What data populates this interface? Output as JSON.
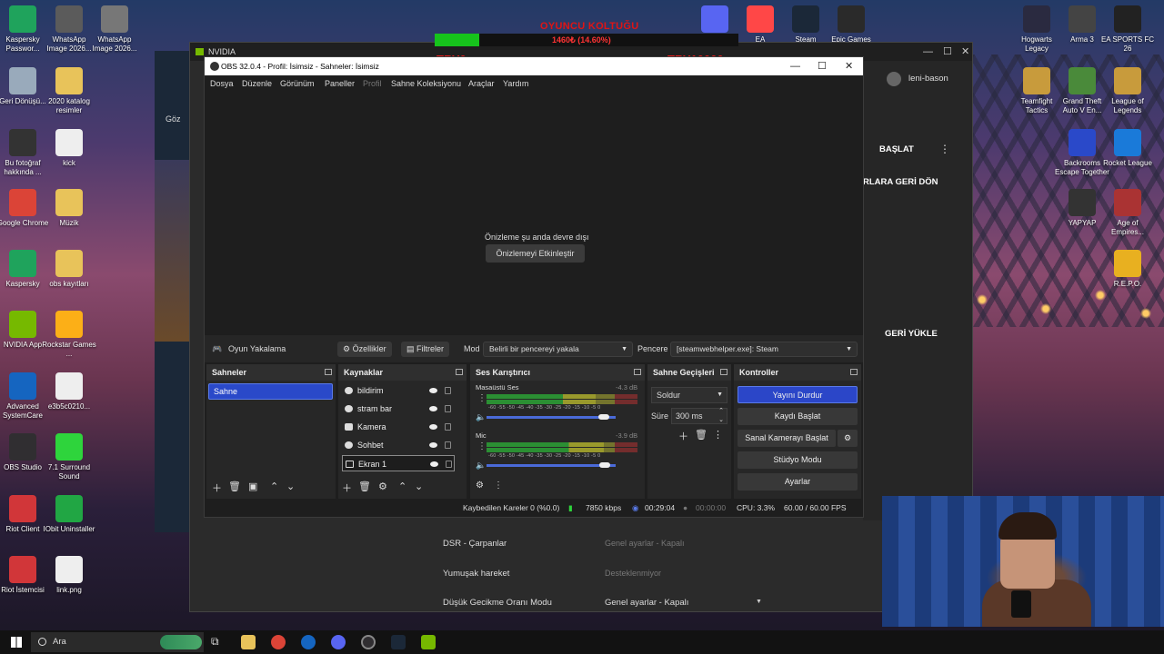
{
  "overlay": {
    "title": "OYUNCU KOLTUĞU",
    "amount": "1460₺ (14.60%)",
    "progress_fraction": 0.146,
    "left_label": "TRY0",
    "right_label": "TRY10000"
  },
  "desktop_left": [
    {
      "label": "Kaspersky Passwor...",
      "color": "#1fa35c"
    },
    {
      "label": "WhatsApp Image 2026...",
      "color": "#5b5b5b"
    },
    {
      "label": "WhatsApp Image 2026...",
      "color": "#777777"
    },
    {
      "label": "Geri Dönüşü...",
      "color": "#9ab"
    },
    {
      "label": "2020 katalog resimler",
      "color": "#e8c35a"
    },
    {
      "label": "Bu fotoğraf hakkında ...",
      "color": "#333"
    },
    {
      "label": "kick",
      "color": "#eee"
    },
    {
      "label": "Google Chrome",
      "color": "#db4437"
    },
    {
      "label": "Müzik",
      "color": "#e8c35a"
    },
    {
      "label": "Kaspersky",
      "color": "#1fa35c"
    },
    {
      "label": "obs kayıtları",
      "color": "#e8c35a"
    },
    {
      "label": "NVIDIA App",
      "color": "#76b900"
    },
    {
      "label": "Rockstar Games ...",
      "color": "#fcaf17"
    },
    {
      "label": "Advanced SystemCare",
      "color": "#1565c0"
    },
    {
      "label": "e3b5c0210...",
      "color": "#eee"
    },
    {
      "label": "OBS Studio",
      "color": "#302e31"
    },
    {
      "label": "7.1 Surround Sound",
      "color": "#2ed43c"
    },
    {
      "label": "Riot Client",
      "color": "#d13639"
    },
    {
      "label": "IObit Uninstaller",
      "color": "#21a644"
    },
    {
      "label": "Riot İstemcisi",
      "color": "#d13639"
    },
    {
      "label": "link.png",
      "color": "#eee"
    }
  ],
  "desktop_top": [
    {
      "label": "",
      "color": "#5865f2"
    },
    {
      "label": "EA",
      "color": "#ff4747"
    },
    {
      "label": "Steam",
      "color": "#1b2838"
    },
    {
      "label": "Epic Games",
      "color": "#2a2a2a"
    }
  ],
  "desktop_right": [
    {
      "label": "Hogwarts Legacy",
      "color": "#2a2a40"
    },
    {
      "label": "Arma 3",
      "color": "#444"
    },
    {
      "label": "EA SPORTS FC 26",
      "color": "#222"
    },
    {
      "label": "Teamfight Tactics",
      "color": "#c89b3c"
    },
    {
      "label": "Grand Theft Auto V En...",
      "color": "#4a8a3a"
    },
    {
      "label": "League of Legends",
      "color": "#c89b3c"
    },
    {
      "label": "Backrooms Escape Together",
      "color": "#2a49c9"
    },
    {
      "label": "Rocket League",
      "color": "#1a7ad9"
    },
    {
      "label": "YAPYAP",
      "color": "#333"
    },
    {
      "label": "Age of Empires...",
      "color": "#a33"
    },
    {
      "label": "R.E.P.O.",
      "color": "#e8b020"
    }
  ],
  "nvidia": {
    "title": "NVIDIA",
    "user": "leni-bason",
    "start_label": "BAŞLAT",
    "back_label": "RLARA GERİ DÖN",
    "reload_label": "GERİ YÜKLE",
    "side_letters": [
      "Göz"
    ],
    "rows": [
      {
        "label": "DSR - Çarpanlar",
        "value": "Genel ayarlar - Kapalı"
      },
      {
        "label": "Yumuşak hareket",
        "value": "Desteklenmiyor"
      },
      {
        "label": "Düşük Gecikme Oranı Modu",
        "value": "Genel ayarlar - Kapalı"
      }
    ]
  },
  "obs": {
    "title": "OBS 32.0.4 - Profil: İsimsiz - Sahneler: İsimsiz",
    "menu": [
      "Dosya",
      "Düzenle",
      "Görünüm",
      "Paneller",
      "Profil",
      "Sahne Koleksiyonu",
      "Araçlar",
      "Yardım"
    ],
    "preview_disabled": "Önizleme şu anda devre dışı",
    "enable_preview": "Önizlemeyi Etkinleştir",
    "source_bar": {
      "selected_source": "Oyun Yakalama",
      "properties": "Özellikler",
      "filters": "Filtreler",
      "mode_label": "Mod",
      "mode_value": "Belirli bir pencereyi yakala",
      "window_label": "Pencere",
      "window_value": "[steamwebhelper.exe]: Steam"
    },
    "docks": {
      "scenes": {
        "title": "Sahneler",
        "items": [
          "Sahne"
        ]
      },
      "sources": {
        "title": "Kaynaklar",
        "items": [
          "bildirim",
          "stram bar",
          "Kamera",
          "Sohbet",
          "Ekran 1"
        ]
      },
      "mixer": {
        "title": "Ses Karıştırıcı",
        "tracks": [
          {
            "name": "Masaüstü Ses",
            "db": "-4.3 dB",
            "level": 0.72,
            "volume": 0.92
          },
          {
            "name": "Mic",
            "db": "-3.9 dB",
            "level": 0.78,
            "volume": 0.93
          }
        ],
        "scale": "-60 -55 -50 -45 -40 -35 -30 -25 -20 -15 -10 -5 0"
      },
      "transitions": {
        "title": "Sahne Geçişleri",
        "type": "Soldur",
        "duration_label": "Süre",
        "duration": "300 ms"
      },
      "controls": {
        "title": "Kontroller",
        "stop_stream": "Yayını Durdur",
        "start_record": "Kaydı Başlat",
        "virtual_cam": "Sanal Kamerayı Başlat",
        "studio_mode": "Stüdyo Modu",
        "settings": "Ayarlar"
      }
    },
    "status": {
      "dropped": "Kaybedilen Kareler 0 (%0.0)",
      "bitrate": "7850 kbps",
      "stream_time": "00:29:04",
      "rec_time": "00:00:00",
      "cpu": "CPU: 3.3%",
      "fps": "60.00 / 60.00 FPS"
    }
  },
  "taskbar": {
    "search_placeholder": "Ara"
  }
}
